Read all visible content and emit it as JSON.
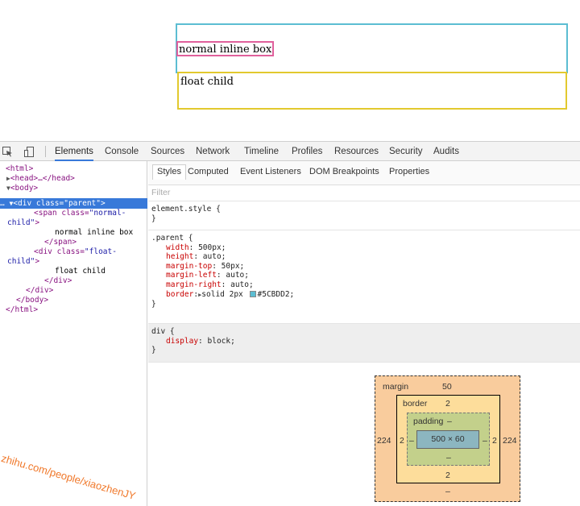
{
  "demo": {
    "span_text": "normal inline box",
    "float_text": "float child"
  },
  "devtools": {
    "icons": [
      "inspect-icon",
      "device-mode-icon"
    ],
    "tabs": [
      "Elements",
      "Console",
      "Sources",
      "Network",
      "Timeline",
      "Profiles",
      "Resources",
      "Security",
      "Audits"
    ],
    "active_tab": "Elements",
    "dom": {
      "html_open": "<html>",
      "head": "<head>…</head>",
      "body_open": "<body>",
      "div_prefix": "<div class=",
      "div_class": "\"parent\"",
      "div_suffix": ">",
      "span_prefix": "<span class=",
      "span_class_a": "\"normal-",
      "span_class_b": "child\"",
      "span_suffix": ">",
      "span_text": "normal inline box",
      "span_close": "</span>",
      "inner_div_prefix": "<div class=",
      "inner_div_class_a": "\"float-",
      "inner_div_class_b": "child\"",
      "inner_div_suffix": ">",
      "inner_div_text": "float child",
      "inner_div_close": "</div>",
      "div_close": "</div>",
      "body_close": "</body>",
      "html_close": "</html>",
      "ellipsis": "…"
    },
    "subtabs": [
      "Styles",
      "Computed",
      "Event Listeners",
      "DOM Breakpoints",
      "Properties"
    ],
    "active_subtab": "Styles",
    "filter_placeholder": "Filter",
    "rules": {
      "element_style": {
        "selector": "element.style {",
        "close": "}"
      },
      "parent": {
        "selector": ".parent {",
        "props": [
          {
            "name": "width",
            "value": "500px;"
          },
          {
            "name": "height",
            "value": "auto;"
          },
          {
            "name": "margin-top",
            "value": "50px;"
          },
          {
            "name": "margin-left",
            "value": "auto;"
          },
          {
            "name": "margin-right",
            "value": "auto;"
          }
        ],
        "border_name": "border",
        "border_value_a": "solid 2px",
        "border_value_b": "#5CBDD2;",
        "close": "}"
      },
      "div": {
        "selector": "div {",
        "prop_name": "display",
        "prop_value": "block;",
        "close": "}"
      }
    },
    "box_model": {
      "margin_label": "margin",
      "margin_top": "50",
      "margin_left": "224",
      "margin_right": "224",
      "margin_bottom": "–",
      "border_label": "border",
      "border_top": "2",
      "border_left": "2",
      "border_right": "2",
      "border_bottom": "2",
      "padding_label": "padding",
      "padding_top": "–",
      "padding_left": "–",
      "padding_right": "–",
      "padding_bottom": "–",
      "content": "500 × 60"
    }
  },
  "watermark": "zhihu.com/people/xiaozhenJY",
  "colors": {
    "parent_border": "#5CBDD2",
    "span_border": "#e0609c",
    "float_border": "#e2c92e",
    "selection": "#3879d9"
  }
}
